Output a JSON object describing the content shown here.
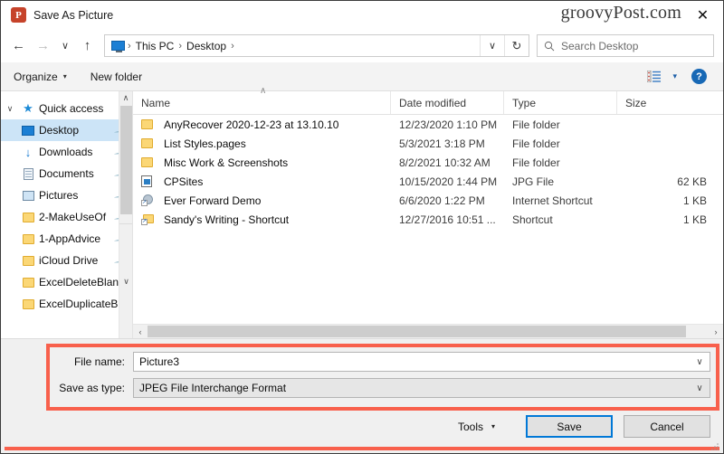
{
  "titlebar": {
    "app_icon": "powerpoint-icon",
    "title": "Save As Picture",
    "watermark": "groovyPost.com",
    "close_label": "✕"
  },
  "navbar": {
    "back_label": "←",
    "forward_label": "→",
    "recent_label": "∨",
    "up_label": "↑",
    "breadcrumbs": [
      "This PC",
      "Desktop"
    ],
    "separator": "›",
    "address_chevron": "∨",
    "refresh_label": "↻",
    "search_placeholder": "Search Desktop"
  },
  "commandbar": {
    "organize_label": "Organize",
    "organize_caret": "▾",
    "new_folder_label": "New folder",
    "view_caret": "▾",
    "help_label": "?"
  },
  "sidebar": {
    "items": [
      {
        "label": "Quick access",
        "icon": "star-icon",
        "expander": "∨",
        "level": 0,
        "selected": false,
        "pinned": false
      },
      {
        "label": "Desktop",
        "icon": "desktop-icon",
        "level": 1,
        "selected": true,
        "pinned": true
      },
      {
        "label": "Downloads",
        "icon": "download-icon",
        "level": 1,
        "selected": false,
        "pinned": true
      },
      {
        "label": "Documents",
        "icon": "document-icon",
        "level": 1,
        "selected": false,
        "pinned": true
      },
      {
        "label": "Pictures",
        "icon": "pictures-icon",
        "level": 1,
        "selected": false,
        "pinned": true
      },
      {
        "label": "2-MakeUseOf",
        "icon": "folder-icon",
        "level": 1,
        "selected": false,
        "pinned": true
      },
      {
        "label": "1-AppAdvice",
        "icon": "folder-icon",
        "level": 1,
        "selected": false,
        "pinned": true
      },
      {
        "label": "iCloud Drive",
        "icon": "folder-icon",
        "level": 1,
        "selected": false,
        "pinned": true
      },
      {
        "label": "ExcelDeleteBlanl",
        "icon": "folder-icon",
        "level": 1,
        "selected": false,
        "pinned": false
      },
      {
        "label": "ExcelDuplicateBl",
        "icon": "folder-icon",
        "level": 1,
        "selected": false,
        "pinned": false
      }
    ],
    "scroll_up": "∧",
    "scroll_down": "∨"
  },
  "filelist": {
    "columns": [
      "Name",
      "Date modified",
      "Type",
      "Size"
    ],
    "sort_indicator": "∧",
    "rows": [
      {
        "name": "AnyRecover 2020-12-23 at 13.10.10",
        "date": "12/23/2020 1:10 PM",
        "type": "File folder",
        "size": "",
        "icon": "folder-icon"
      },
      {
        "name": "List Styles.pages",
        "date": "5/3/2021 3:18 PM",
        "type": "File folder",
        "size": "",
        "icon": "folder-icon"
      },
      {
        "name": "Misc Work & Screenshots",
        "date": "8/2/2021 10:32 AM",
        "type": "File folder",
        "size": "",
        "icon": "folder-icon"
      },
      {
        "name": "CPSites",
        "date": "10/15/2020 1:44 PM",
        "type": "JPG File",
        "size": "62 KB",
        "icon": "jpg-file-icon"
      },
      {
        "name": "Ever Forward Demo",
        "date": "6/6/2020 1:22 PM",
        "type": "Internet Shortcut",
        "size": "1 KB",
        "icon": "internet-shortcut-icon"
      },
      {
        "name": "Sandy's Writing - Shortcut",
        "date": "12/27/2016 10:51 ...",
        "type": "Shortcut",
        "size": "1 KB",
        "icon": "folder-shortcut-icon"
      }
    ],
    "hscroll_left": "‹",
    "hscroll_right": "›"
  },
  "form": {
    "file_name_label": "File name:",
    "file_name_value": "Picture3",
    "save_as_type_label": "Save as type:",
    "save_as_type_value": "JPEG File Interchange Format",
    "combo_caret": "∨"
  },
  "buttons": {
    "tools_label": "Tools",
    "tools_caret": "▾",
    "save_label": "Save",
    "cancel_label": "Cancel"
  },
  "colors": {
    "annotation_red": "#f8604c",
    "selection_blue": "#cce4f7",
    "focus_blue": "#0078d7",
    "accent_blue": "#1768b5"
  }
}
